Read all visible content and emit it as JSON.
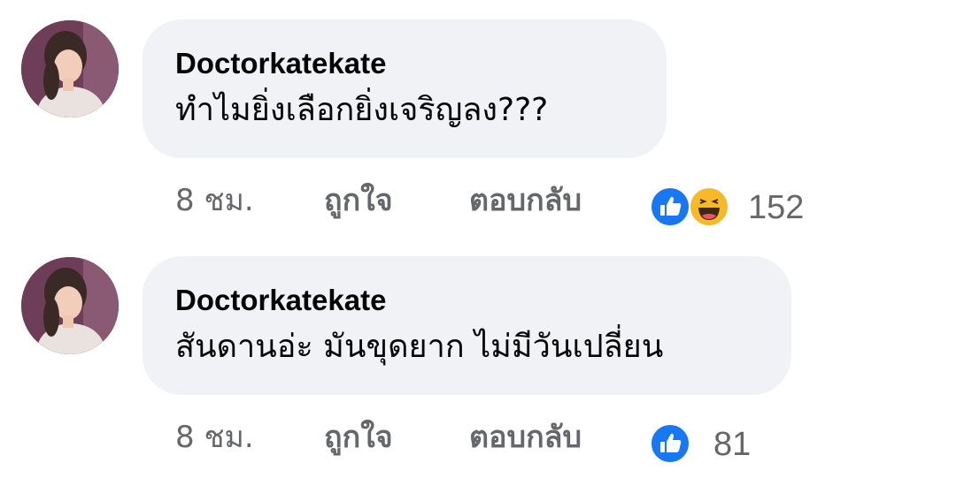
{
  "comments": [
    {
      "author": "Doctorkatekate",
      "text": "ทำไมยิ่งเลือกยิ่งเจริญลง???",
      "time": "8 ชม.",
      "like_label": "ถูกใจ",
      "reply_label": "ตอบกลับ",
      "reactions": [
        "like-icon",
        "haha-icon"
      ],
      "reaction_count": "152"
    },
    {
      "author": "Doctorkatekate",
      "text": "สันดานอ่ะ มันขุดยาก ไม่มีวันเปลี่ยน",
      "time": "8 ชม.",
      "like_label": "ถูกใจ",
      "reply_label": "ตอบกลับ",
      "reactions": [
        "like-icon"
      ],
      "reaction_count": "81"
    }
  ],
  "colors": {
    "bubble": "#f0f2f5",
    "meta_text": "#65676b",
    "like_blue": "#1877f2",
    "haha_yellow": "#f7b928"
  }
}
